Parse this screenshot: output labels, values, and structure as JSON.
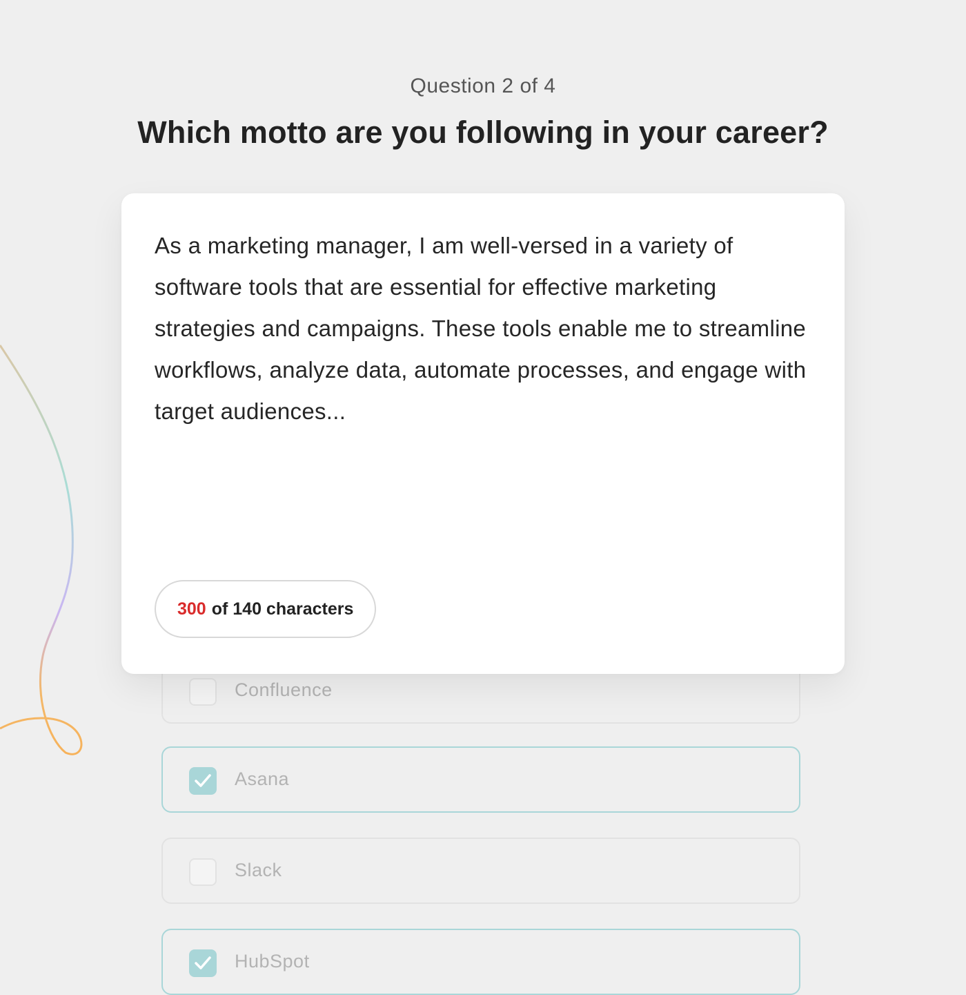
{
  "header": {
    "counter": "Question 2 of 4",
    "question": "Which motto are you following in your career?"
  },
  "answer": {
    "text": "As a marketing manager, I am well-versed in a variety of software tools that are essential for effective marketing strategies and campaigns. These tools enable me to streamline workflows, analyze data, automate processes, and engage with target audiences...",
    "char_count": "300",
    "char_suffix": "of 140 characters"
  },
  "options": [
    {
      "label": "Confluence",
      "checked": false
    },
    {
      "label": "Asana",
      "checked": true
    },
    {
      "label": "Slack",
      "checked": false
    },
    {
      "label": "HubSpot",
      "checked": true
    }
  ],
  "colors": {
    "background": "#efefef",
    "accent_checked": "#a9d6d8",
    "over_limit": "#d92b2b"
  }
}
